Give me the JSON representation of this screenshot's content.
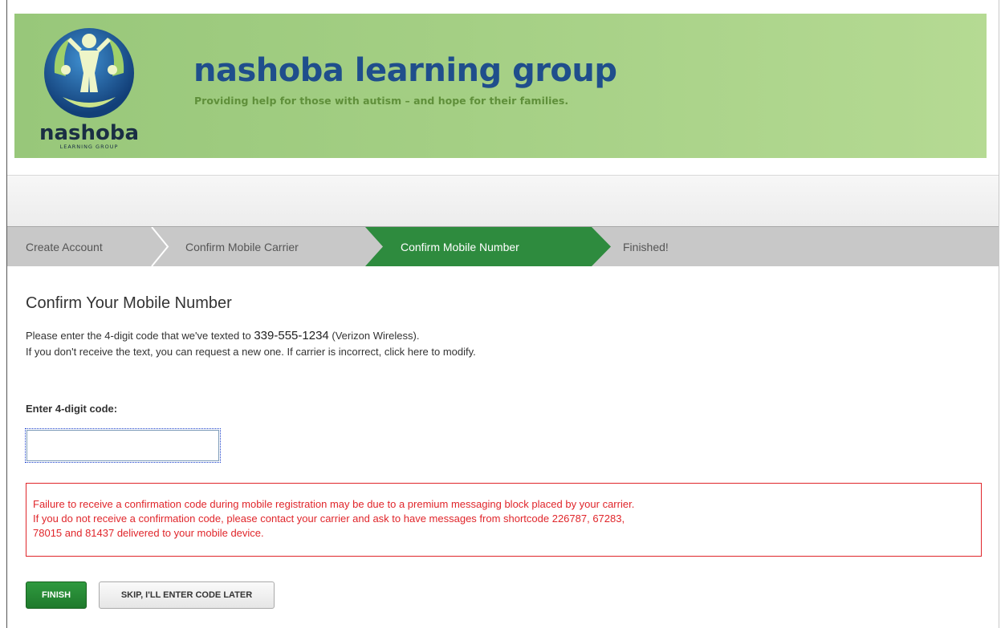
{
  "header": {
    "brand_name": "nashoba learning group",
    "tagline": "Providing help for those with autism – and hope for their families.",
    "logo_text": "nashoba",
    "logo_subtext": "LEARNING GROUP"
  },
  "steps": [
    {
      "label": "Create Account",
      "active": false
    },
    {
      "label": "Confirm Mobile Carrier",
      "active": false
    },
    {
      "label": "Confirm Mobile Number",
      "active": true
    },
    {
      "label": "Finished!",
      "active": false
    }
  ],
  "main": {
    "title": "Confirm Your Mobile Number",
    "instruction_prefix": "Please enter the 4-digit code that we've texted to",
    "phone_number": "339-555-1234",
    "carrier": "(Verizon Wireless).",
    "instruction_line2": "If you don't receive the text, you can request a new one. If carrier is incorrect, click here to modify.",
    "code_label": "Enter 4-digit code:",
    "code_value": "",
    "alert_line1": "Failure to receive a confirmation code during mobile registration may be due to a premium messaging block placed by your carrier.",
    "alert_line2": "If you do not receive a confirmation code, please contact your carrier and ask to have messages from shortcode 226787, 67283,",
    "alert_line3": "78015 and 81437 delivered to your mobile device."
  },
  "buttons": {
    "finish": "FINISH",
    "skip": "SKIP, I'LL ENTER CODE LATER"
  },
  "colors": {
    "brand_blue": "#1f4e8c",
    "banner_green": "#a4cf84",
    "active_step_green": "#2e8b3e",
    "alert_red": "#e0262b"
  }
}
